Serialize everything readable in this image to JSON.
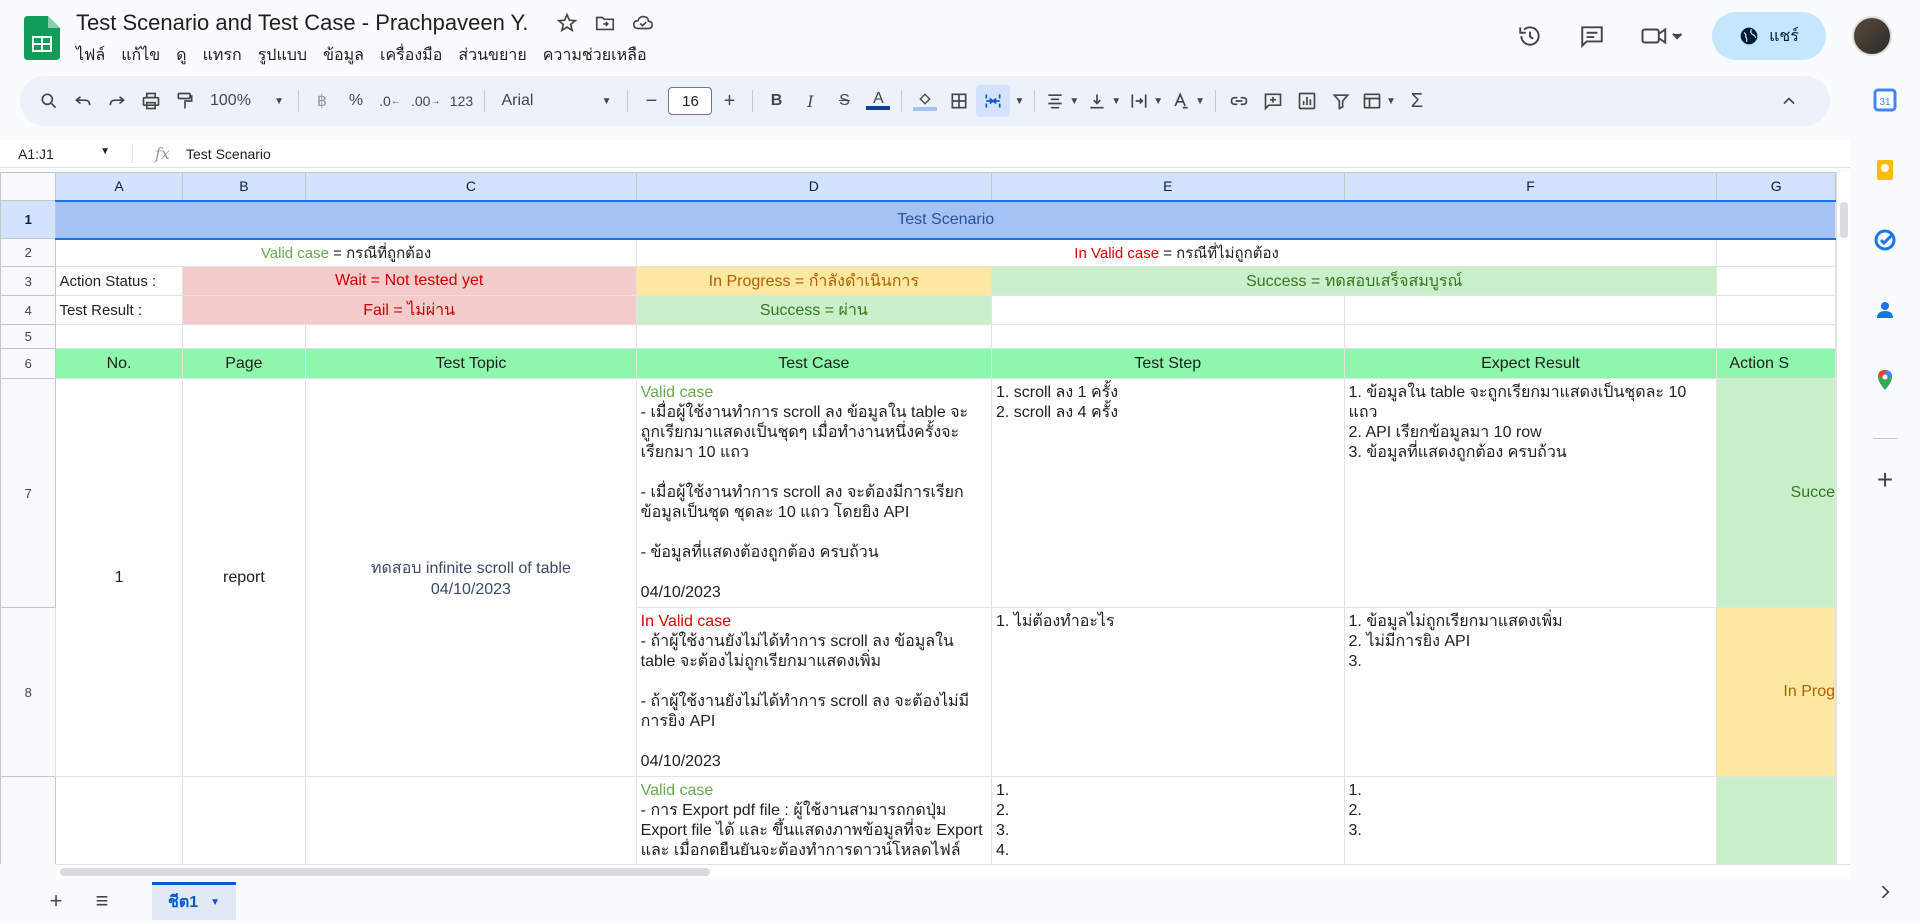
{
  "app": {
    "doc_title": "Test Scenario and Test Case - Prachpaveen Y.",
    "menu": [
      "ไฟล์",
      "แก้ไข",
      "ดู",
      "แทรก",
      "รูปแบบ",
      "ข้อมูล",
      "เครื่องมือ",
      "ส่วนขยาย",
      "ความช่วยเหลือ"
    ],
    "share_label": "แชร์"
  },
  "toolbar": {
    "zoom": "100%",
    "currency": "฿",
    "percent": "%",
    "dec_less": ".0",
    "dec_more": ".00",
    "format_123": "123",
    "font": "Arial",
    "font_size": "16",
    "bold": "B",
    "italic": "I",
    "text_color": "A"
  },
  "formula_bar": {
    "name_box": "A1:J1",
    "fx": "fx",
    "value": "Test Scenario"
  },
  "columns": [
    "A",
    "B",
    "C",
    "D",
    "E",
    "F",
    "G"
  ],
  "rows": [
    "1",
    "2",
    "3",
    "4",
    "5",
    "6",
    "7",
    "8"
  ],
  "sheet": {
    "title": "Test Scenario",
    "valid_word": "Valid case",
    "valid_rest": " = กรณีที่ถูกต้อง",
    "invalid_word": "In Valid case",
    "invalid_rest": " = กรณีที่ไม่ถูกต้อง",
    "action_status_label": "Action Status :",
    "wait": "Wait = Not tested yet",
    "in_progress": "In Progress = กำลังดำเนินการ",
    "success_action": "Success = ทดสอบเสร็จสมบูรณ์",
    "test_result_label": "Test Result :",
    "fail": "Fail = ไม่ผ่าน",
    "success_result": "Success = ผ่าน",
    "headers": [
      "No.",
      "Page",
      "Test Topic",
      "Test Case",
      "Test Step",
      "Expect Result",
      "Action S"
    ],
    "case1": {
      "no": "1",
      "page": "report",
      "topic_line1": "ทดสอบ infinite scroll of table",
      "topic_line2": "04/10/2023",
      "valid_label": "Valid case",
      "case_lines": [
        " - เมื่อผู้ใช้งานทำการ scroll ลง ข้อมูลใน table จะถูกเรียกมาแสดงเป็นชุดๆ เมื่อทำงานหนึ่งครั้งจะเรียกมา 10 แถว",
        "",
        "- เมื่อผู้ใช้งานทำการ scroll ลง จะต้องมีการเรียกข้อมูลเป็นชุด ชุดละ 10 แถว โดยยิง API",
        "",
        "- ข้อมูลที่แสดงต้องถูกต้อง ครบถ้วน",
        "",
        "04/10/2023"
      ],
      "steps": [
        "1. scroll ลง 1 ครั้ง",
        "2. scroll ลง 4 ครั้ง"
      ],
      "expect": [
        "1. ข้อมูลใน table จะถูกเรียกมาแสดงเป็นชุดละ 10 แถว",
        "2. API เรียกข้อมูลมา 10 row",
        "3. ข้อมูลที่แสดงถูกต้อง ครบถ้วน"
      ],
      "status": "Succe"
    },
    "case2": {
      "invalid_label": "In Valid case",
      "case_lines": [
        " - ถ้าผู้ใช้งานยังไม่ได้ทำการ scroll ลง ข้อมูลใน table จะต้องไม่ถูกเรียกมาแสดงเพิ่ม",
        "",
        "- ถ้าผู้ใช้งานยังไม่ได้ทำการ scroll ลง จะต้องไม่มีการยิง API",
        "",
        "04/10/2023"
      ],
      "steps": [
        "1. ไม่ต้องทำอะไร"
      ],
      "expect": [
        "1. ข้อมูลไม่ถูกเรียกมาแสดงเพิ่ม",
        "2. ไม่มีการยิง API",
        "3."
      ],
      "status": "In Prog"
    },
    "case3": {
      "valid_label": "Valid case",
      "case_lines": [
        " - การ Export pdf file : ผู้ใช้งานสามารถกดปุ่ม Export file ได้ และ ขึ้นแสดงภาพข้อมูลที่จะ Export และ เมื่อกดยืนยันจะต้องทำการดาวน์โหลดไฟล์"
      ],
      "steps": [
        "1.",
        "2.",
        "3.",
        "4."
      ],
      "expect": [
        "1.",
        "2.",
        "3."
      ]
    }
  },
  "sheet_tab": "ชีต1"
}
